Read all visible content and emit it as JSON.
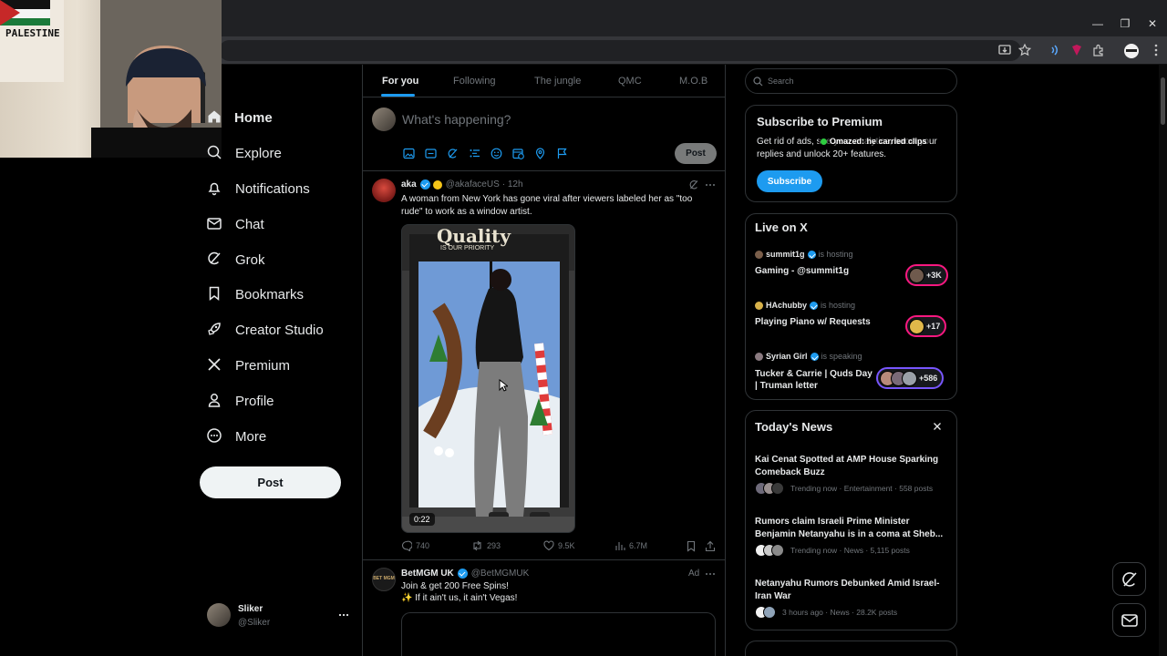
{
  "nav": {
    "items": [
      {
        "label": "Home",
        "icon": "home-icon"
      },
      {
        "label": "Explore",
        "icon": "search-icon"
      },
      {
        "label": "Notifications",
        "icon": "bell-icon"
      },
      {
        "label": "Chat",
        "icon": "mail-icon"
      },
      {
        "label": "Grok",
        "icon": "grok-icon"
      },
      {
        "label": "Bookmarks",
        "icon": "bookmark-icon"
      },
      {
        "label": "Creator Studio",
        "icon": "rocket-icon"
      },
      {
        "label": "Premium",
        "icon": "x-logo-icon"
      },
      {
        "label": "Profile",
        "icon": "person-icon"
      },
      {
        "label": "More",
        "icon": "more-circle-icon"
      }
    ],
    "post_label": "Post",
    "account": {
      "name": "Sliker",
      "handle": "@Sliker"
    }
  },
  "webcam": {
    "poster_text": "PALESTINE"
  },
  "tabs": [
    "For you",
    "Following",
    "The jungle",
    "QMC",
    "M.O.B"
  ],
  "composer": {
    "placeholder": "What's happening?",
    "post_label": "Post"
  },
  "tweets": [
    {
      "name": "aka",
      "handle": "@akafaceUS",
      "time": "· 12h",
      "text": "A woman from New York has gone viral after viewers labeled her as \"too rude\" to work as a window artist.",
      "media_sign": "Quality",
      "media_sign_sub": "IS OUR PRIORITY",
      "video_duration": "0:22",
      "replies": "740",
      "reposts": "293",
      "likes": "9.5K",
      "views": "6.7M"
    },
    {
      "name": "BetMGM UK",
      "handle": "@BetMGMUK",
      "ad_label": "Ad",
      "avatar_text": "BET MGM",
      "line1": "Join & get 200 Free Spins!",
      "line2": "✨ If it ain't us, it ain't Vegas!"
    }
  ],
  "search": {
    "placeholder": "Search"
  },
  "premium": {
    "title": "Subscribe to Premium",
    "text": "Get rid of ads, see your analytics, boost your replies and unlock 20+ features.",
    "overlay": "Omazed: he carried clips",
    "button": "Subscribe"
  },
  "live": {
    "title": "Live on X",
    "items": [
      {
        "user": "summit1g",
        "status": "is hosting",
        "title": "Gaming - @summit1g",
        "count": "+3K"
      },
      {
        "user": "HAchubby",
        "status": "is hosting",
        "title": "Playing Piano w/ Requests",
        "count": "+17"
      },
      {
        "user": "Syrian Girl",
        "status": "is speaking",
        "title": "Tucker & Carrie | Quds Day | Truman letter",
        "count": "+586"
      }
    ]
  },
  "news": {
    "title": "Today's News",
    "items": [
      {
        "title": "Kai Cenat Spotted at AMP House Sparking Comeback Buzz",
        "meta": "Trending now · Entertainment · 558 posts"
      },
      {
        "title": "Rumors claim Israeli Prime Minister Benjamin Netanyahu is in a coma at Sheb...",
        "meta": "Trending now · News · 5,115 posts"
      },
      {
        "title": "Netanyahu Rumors Debunked Amid Israel-Iran War",
        "meta": "3 hours ago · News · 28.2K posts"
      }
    ]
  },
  "colors": {
    "accent": "#1d9bf0",
    "background": "#000000",
    "border": "#2f3336",
    "live_pink": "#f91880"
  }
}
